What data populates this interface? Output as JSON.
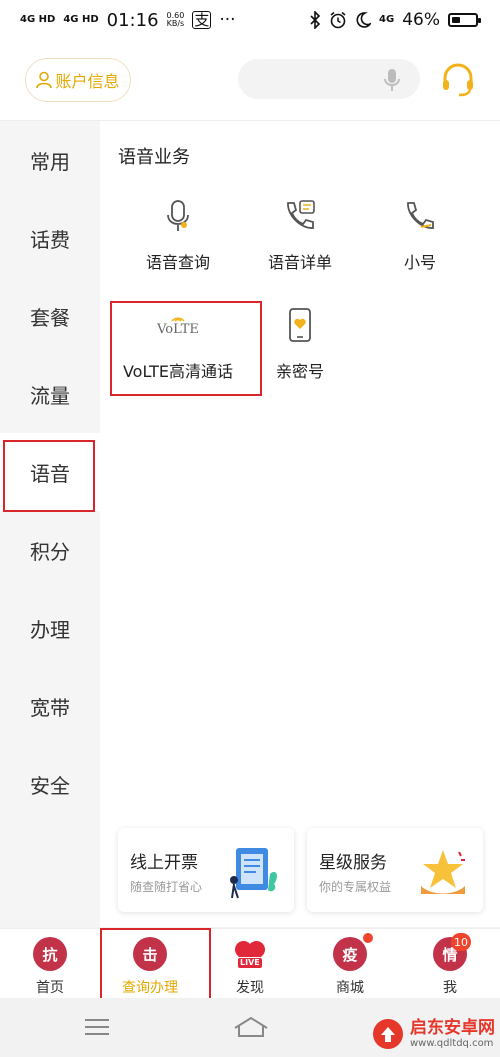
{
  "status_bar": {
    "signal1": "4G HD",
    "signal2": "4G HD",
    "time": "01:16",
    "speed_value": "0.60",
    "speed_unit": "KB/s",
    "app_icon_glyph": "支",
    "more": "···",
    "net_label": "4G",
    "battery_percent": "46%",
    "battery_level": 0.46
  },
  "header": {
    "account_label": "账户信息",
    "search_placeholder": "",
    "icons": [
      "person-icon",
      "microphone-icon",
      "headset-icon"
    ],
    "accent_color": "#e5a800"
  },
  "sidebar": {
    "items": [
      {
        "label": "常用"
      },
      {
        "label": "话费"
      },
      {
        "label": "套餐"
      },
      {
        "label": "流量"
      },
      {
        "label": "语音",
        "active": true
      },
      {
        "label": "积分"
      },
      {
        "label": "办理"
      },
      {
        "label": "宽带"
      },
      {
        "label": "安全"
      }
    ]
  },
  "content": {
    "section_title": "语音业务",
    "services": [
      {
        "label": "语音查询",
        "icon": "microphone-icon"
      },
      {
        "label": "语音详单",
        "icon": "phone-list-icon"
      },
      {
        "label": "小号",
        "icon": "phone-icon"
      },
      {
        "label": "VoLTE高清通话",
        "icon": "volte-icon",
        "icon_text": "VoLTE"
      },
      {
        "label": "亲密号",
        "icon": "heart-phone-icon"
      }
    ],
    "promos": [
      {
        "title": "线上开票",
        "subtitle": "随查随打省心"
      },
      {
        "title": "星级服务",
        "subtitle": "你的专属权益"
      }
    ]
  },
  "tab_bar": {
    "tabs": [
      {
        "label": "首页",
        "icon_char": "抗",
        "color": "#c2334a"
      },
      {
        "label": "查询办理",
        "icon_char": "击",
        "color": "#c2334a",
        "active": true
      },
      {
        "label": "发现",
        "icon_char": "LIVE",
        "color": "#e0283a"
      },
      {
        "label": "商城",
        "icon_char": "疫",
        "color": "#c2334a"
      },
      {
        "label": "我",
        "icon_char": "情",
        "color": "#c2334a",
        "badge": "10"
      }
    ]
  },
  "watermark": {
    "title": "启东安卓网",
    "url": "www.qdltdq.com"
  },
  "highlight_color": "#d9262c"
}
